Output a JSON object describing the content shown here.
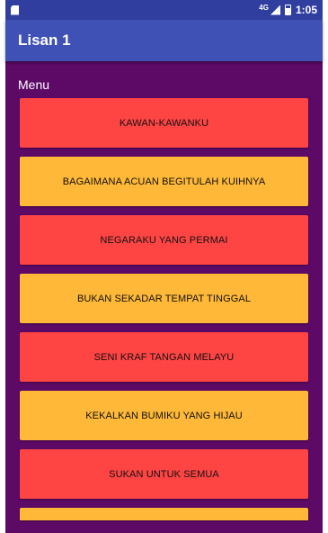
{
  "status_bar": {
    "network": "4G",
    "time": "1:05",
    "icons": [
      "sd-card-icon",
      "signal-icon",
      "battery-icon"
    ]
  },
  "app_bar": {
    "title": "Lisan 1",
    "color": "#3f51b5"
  },
  "content": {
    "background": "#5c0a66",
    "menu_heading": "Menu",
    "menu_items": [
      {
        "label": "KAWAN-KAWANKU",
        "color": "#ff4444"
      },
      {
        "label": "BAGAIMANA ACUAN BEGITULAH KUIHNYA",
        "color": "#ffb838"
      },
      {
        "label": "NEGARAKU YANG PERMAI",
        "color": "#ff4444"
      },
      {
        "label": "BUKAN SEKADAR TEMPAT TINGGAL",
        "color": "#ffb838"
      },
      {
        "label": "SENI KRAF TANGAN MELAYU",
        "color": "#ff4444"
      },
      {
        "label": "KEKALKAN BUMIKU YANG HIJAU",
        "color": "#ffb838"
      },
      {
        "label": "SUKAN UNTUK SEMUA",
        "color": "#ff4444"
      }
    ]
  }
}
